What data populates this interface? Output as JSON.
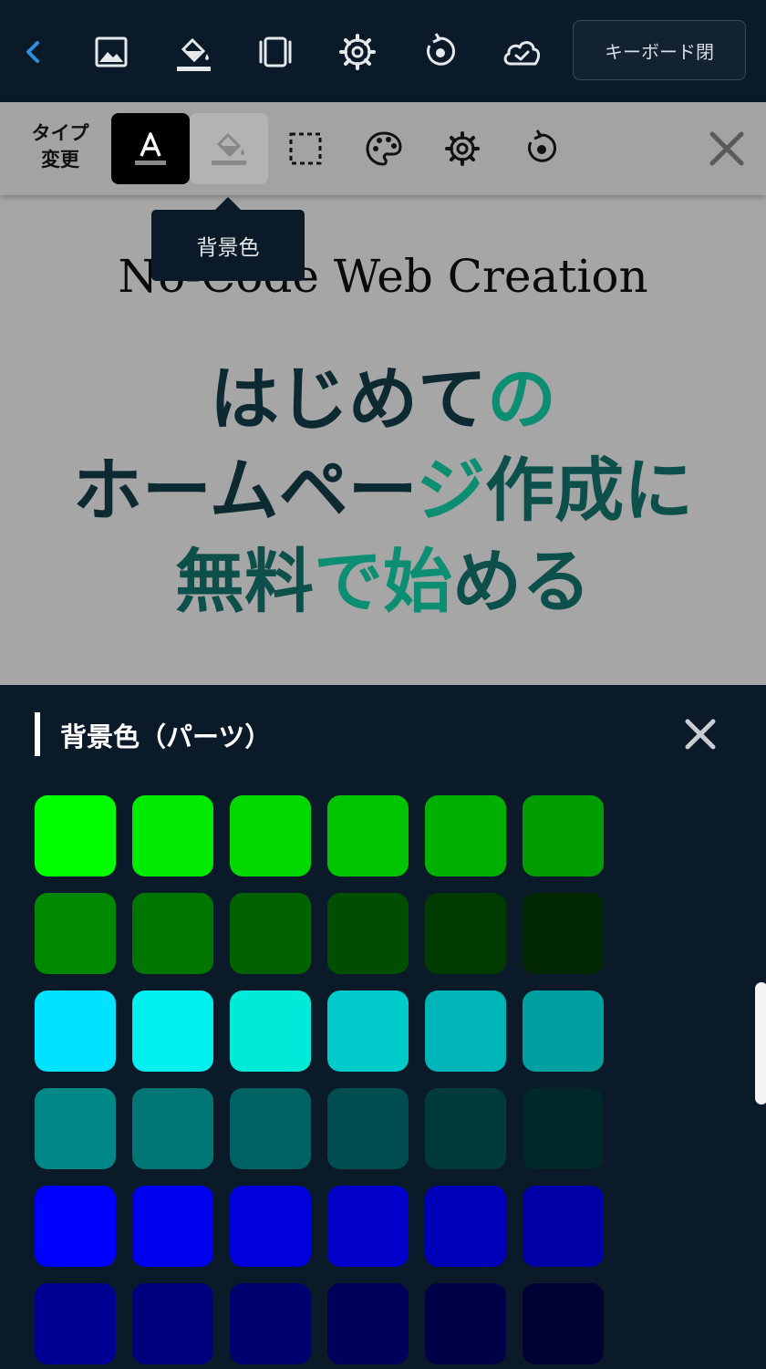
{
  "topbar": {
    "icons": [
      "chevron-left-icon",
      "image-icon",
      "paint-bucket-icon",
      "columns-icon",
      "gear-icon",
      "reset-icon",
      "cloud-check-icon"
    ],
    "keyboard_close_label": "キーボード閉"
  },
  "subbar": {
    "type_change_label_line1": "タイプ",
    "type_change_label_line2": "変更",
    "icons": [
      "text-color-icon",
      "background-color-icon",
      "border-icon",
      "palette-icon",
      "gear-icon",
      "reset-icon",
      "close-icon"
    ],
    "tooltip": "背景色"
  },
  "canvas": {
    "web_title": "No-Code Web Creation",
    "headline": {
      "line1_a": "はじめて",
      "line1_b": "の",
      "line2_a": "ホームペー",
      "line2_b": "ジ",
      "line2_c": "作成に",
      "line3_a": "無料",
      "line3_b": "で始",
      "line3_c": "める"
    }
  },
  "panel": {
    "title": "背景色（パーツ）",
    "swatches": [
      "#00ff00",
      "#00ea00",
      "#00d800",
      "#00c400",
      "#00b000",
      "#009d00",
      "#008800",
      "#007500",
      "#006300",
      "#004f00",
      "#003b00",
      "#002800",
      "#00e2ff",
      "#00efef",
      "#00eada",
      "#00cbcb",
      "#00b5b7",
      "#009fa0",
      "#008889",
      "#007576",
      "#006162",
      "#004d4f",
      "#003a3b",
      "#002829",
      "#0000ff",
      "#0000ee",
      "#0000dd",
      "#0000cb",
      "#0000b8",
      "#0000a6",
      "#000092",
      "#00007f",
      "#00006e",
      "#00005b",
      "#000049",
      "#000034"
    ]
  }
}
